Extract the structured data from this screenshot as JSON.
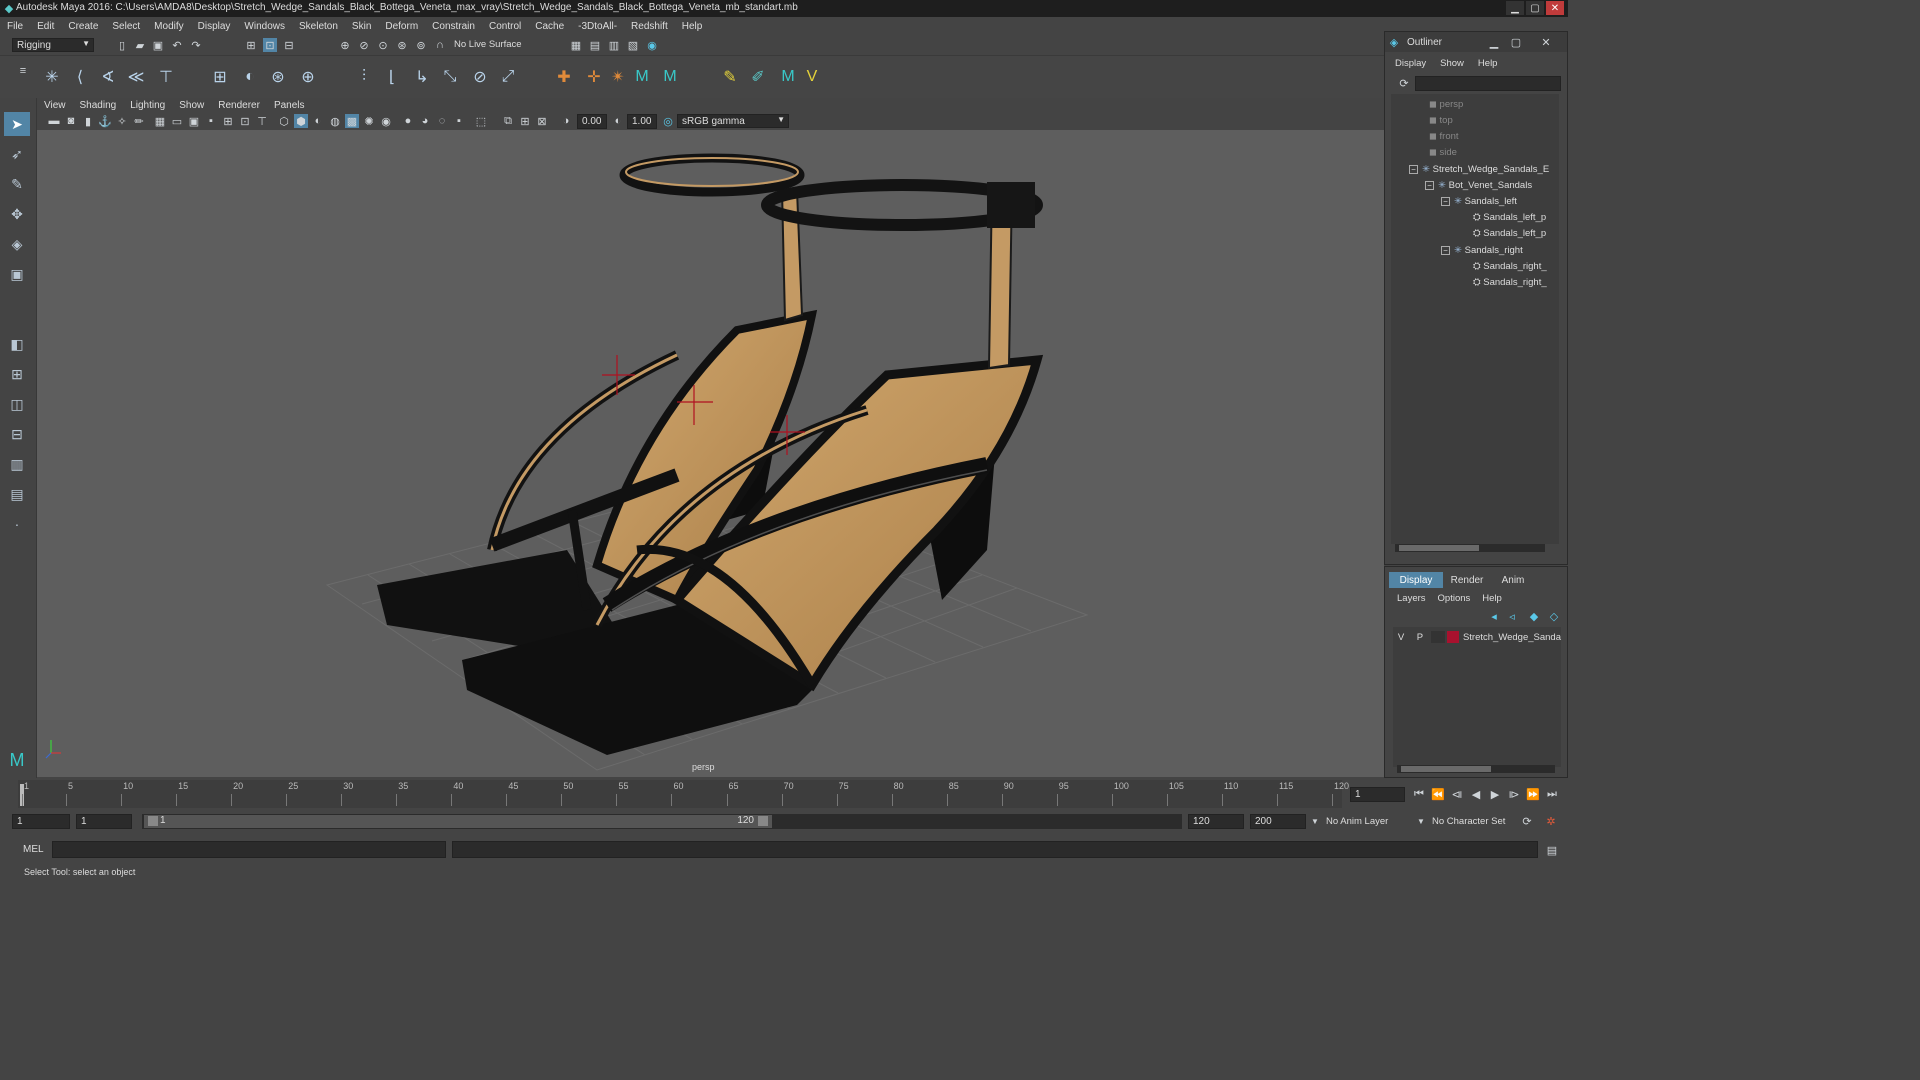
{
  "window": {
    "title": "Autodesk Maya 2016: C:\\Users\\AMDA8\\Desktop\\Stretch_Wedge_Sandals_Black_Bottega_Veneta_max_vray\\Stretch_Wedge_Sandals_Black_Bottega_Veneta_mb_standart.mb"
  },
  "menubar": {
    "items": [
      "File",
      "Edit",
      "Create",
      "Select",
      "Modify",
      "Display",
      "Windows",
      "Skeleton",
      "Skin",
      "Deform",
      "Constrain",
      "Control",
      "Cache",
      "-3DtoAll-",
      "Redshift",
      "Help"
    ]
  },
  "statusline": {
    "mode_selected": "Rigging",
    "live_surface": "No Live Surface"
  },
  "panel": {
    "menu": [
      "View",
      "Shading",
      "Lighting",
      "Show",
      "Renderer",
      "Panels"
    ],
    "exposure": "0.00",
    "gamma": "1.00",
    "color_space": "sRGB gamma",
    "camera_label": "persp"
  },
  "timeline": {
    "ticks": [
      "1",
      "5",
      "10",
      "15",
      "20",
      "25",
      "30",
      "35",
      "40",
      "45",
      "50",
      "55",
      "60",
      "65",
      "70",
      "75",
      "80",
      "85",
      "90",
      "95",
      "100",
      "105",
      "110",
      "115",
      "120"
    ],
    "current_frame": "1"
  },
  "range": {
    "start": "1",
    "playback_start": "1",
    "slider_start": "1",
    "slider_end": "120",
    "playback_end": "120",
    "end": "200",
    "anim_layer": "No Anim Layer",
    "character_set": "No Character Set"
  },
  "mel": {
    "label": "MEL"
  },
  "help_line": "Select Tool: select an object",
  "outliner": {
    "title": "Outliner",
    "menu": [
      "Display",
      "Show",
      "Help"
    ],
    "cameras": [
      "persp",
      "top",
      "front",
      "side"
    ],
    "root": "Stretch_Wedge_Sandals_E",
    "group": "Bot_Venet_Sandals",
    "left": "Sandals_left",
    "left_children": [
      "Sandals_left_p",
      "Sandals_left_p"
    ],
    "right": "Sandals_right",
    "right_children": [
      "Sandals_right_",
      "Sandals_right_"
    ]
  },
  "layer_editor": {
    "tabs": [
      "Display",
      "Render",
      "Anim"
    ],
    "menu": [
      "Layers",
      "Options",
      "Help"
    ],
    "layer": {
      "v": "V",
      "p": "P",
      "name": "Stretch_Wedge_Sanda",
      "color": "#a8112e"
    }
  },
  "colors": {
    "accent": "#5285a6",
    "viewport_bg": "#5e5e5e",
    "leather_tan": "#c49a64",
    "leather_black": "#121212"
  }
}
